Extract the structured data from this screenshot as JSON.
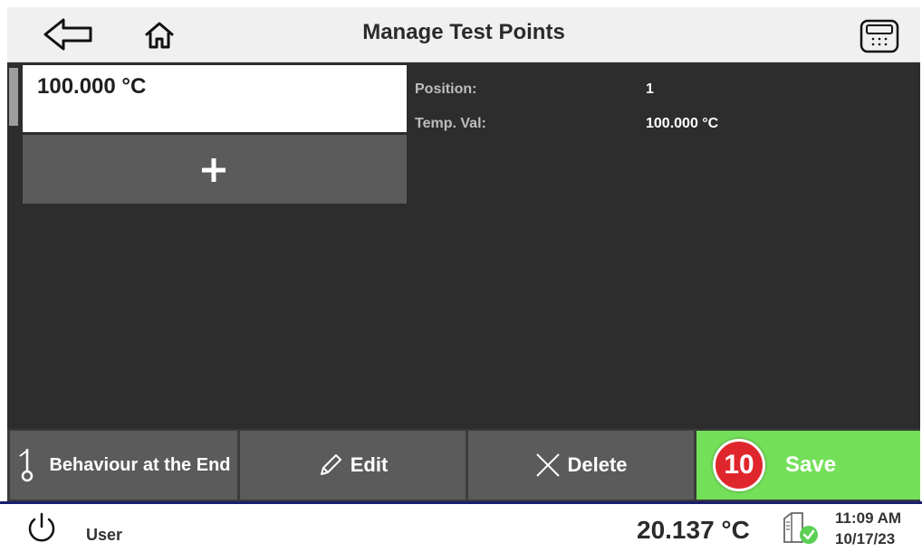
{
  "header": {
    "title": "Manage Test Points",
    "back_icon": "back-arrow-icon",
    "home_icon": "home-icon",
    "calculator_icon": "calculator-icon"
  },
  "test_points": {
    "items": [
      {
        "label": "100.000 °C"
      }
    ],
    "add_icon": "plus-icon"
  },
  "details": {
    "position_label": "Position:",
    "position_value": "1",
    "temp_label": "Temp. Val:",
    "temp_value": "100.000 °C"
  },
  "actions": {
    "behaviour_label": "Behaviour at the End",
    "edit_label": "Edit",
    "delete_label": "Delete",
    "save_label": "Save",
    "save_badge": "10",
    "save_color": "#74e05a",
    "badge_color": "#e0262d"
  },
  "status": {
    "user_label": "User",
    "temperature": "20.137 °C",
    "time": "11:09 AM",
    "date": "10/17/23",
    "power_icon": "power-icon",
    "device_icon": "device-status-icon"
  }
}
